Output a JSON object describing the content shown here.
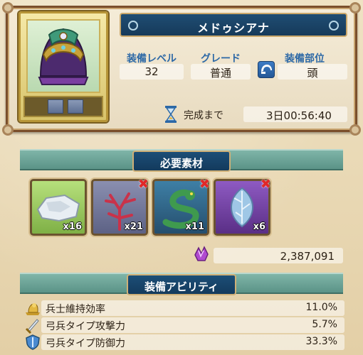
{
  "item": {
    "name": "メドゥシアナ",
    "level_label": "装備レベル",
    "level_value": "32",
    "grade_label": "グレード",
    "grade_value": "普通",
    "slot_label": "装備部位",
    "slot_value": "頭",
    "timer_label": "完成まで",
    "timer_value": "3日00:56:40",
    "icon": "helmet-icon"
  },
  "materials_section": {
    "title": "必要素材",
    "items": [
      {
        "name": "stone-material",
        "count": "x16",
        "missing": false,
        "color": "#8fc15a"
      },
      {
        "name": "coral-material",
        "count": "x21",
        "missing": true,
        "color": "#7a3b3b"
      },
      {
        "name": "serpent-material",
        "count": "x11",
        "missing": true,
        "color": "#2e6a8c"
      },
      {
        "name": "crystal-leaf-material",
        "count": "x6",
        "missing": true,
        "color": "#6d3fa0"
      }
    ],
    "missing_mark": "✖",
    "cost_icon": "gem-icon",
    "cost_value": "2,387,091"
  },
  "abilities_section": {
    "title": "装備アビリティ",
    "rows": [
      {
        "icon": "soldier-upkeep-icon",
        "label": "兵士維持効率",
        "value": "11.0%"
      },
      {
        "icon": "sword-icon",
        "label": "弓兵タイプ攻撃力",
        "value": "5.7%"
      },
      {
        "icon": "shield-icon",
        "label": "弓兵タイプ防御力",
        "value": "33.3%"
      }
    ]
  },
  "colors": {
    "accent_blue": "#1f4d73",
    "label_blue": "#2c68a6",
    "missing_red": "#e02828",
    "section_teal": "#5b9387"
  }
}
